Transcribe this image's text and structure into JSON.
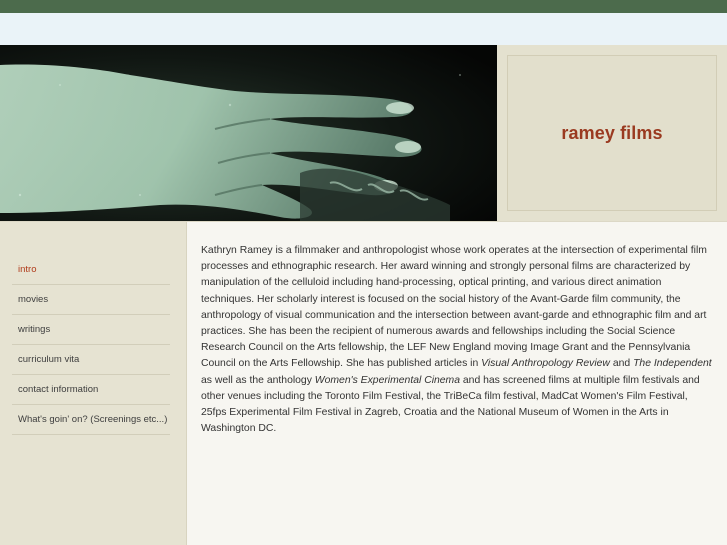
{
  "site": {
    "title": "ramey films"
  },
  "nav": {
    "items": [
      {
        "label": "intro",
        "active": true
      },
      {
        "label": "movies"
      },
      {
        "label": "writings"
      },
      {
        "label": "curriculum vita"
      },
      {
        "label": "contact information"
      },
      {
        "label": "What's goin' on? (Screenings etc...)"
      }
    ]
  },
  "intro": {
    "p1": "Kathryn Ramey is a filmmaker and anthropologist whose work operates at the intersection of experimental film processes and ethnographic research.  Her award winning and strongly personal films are characterized by manipulation of the celluloid including hand-processing, optical printing, and various direct animation techniques. Her scholarly interest is focused on the social history of the Avant-Garde film community, the anthropology of visual communication and the intersection between avant-garde and ethnographic film and art practices.  She has been the recipient of numerous awards and fellowships including the Social Science Research Council on the Arts fellowship, the LEF New England moving Image Grant and the Pennsylvania Council on the Arts Fellowship.  She has published articles in ",
    "em1": "Visual Anthropology Review",
    "t2": " and ",
    "em2": "The Independent",
    "t3": " as well as the anthology ",
    "em3": "Women's Experimental Cinema",
    "t4": " and has screened films at multiple film festivals and other venues including the Toronto Film Festival, the TriBeCa film festival, MadCat Women's Film Festival, 25fps Experimental Film Festival in Zagreb, Croatia and the National Museum of Women in the Arts in Washington DC."
  },
  "colors": {
    "top_bar": "#4c6b4c",
    "sub_bar": "#eaf3f8",
    "brand": "#9a3a20",
    "nav_active": "#b03c1c",
    "sidebar_bg": "#e6e3d2",
    "page_bg": "#f7f6f1"
  }
}
